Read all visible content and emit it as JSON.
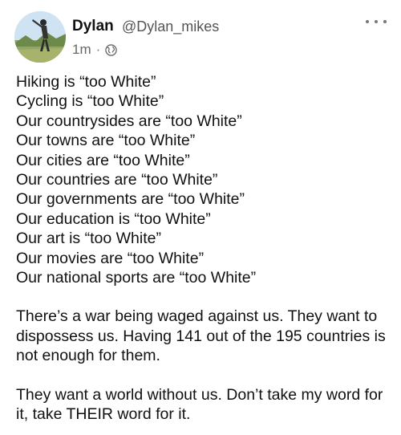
{
  "post": {
    "author_name": "Dylan",
    "author_handle": "@Dylan_mikes",
    "timestamp": "1m",
    "separator": "·",
    "visibility_icon": "globe-icon",
    "more_icon": "more-options-icon",
    "lines": [
      "Hiking is “too White”",
      "Cycling is “too White”",
      "Our countrysides are “too White”",
      "Our towns are “too White”",
      "Our cities are “too White”",
      "Our countries are “too White”",
      "Our governments are “too White”",
      "Our education is “too White”",
      "Our art is “too White”",
      "Our movies are “too White”",
      "Our national sports are “too White”"
    ],
    "paragraph_1": "There’s a war being waged against us. They want to dispossess us. Having 141 out of the 195 countries is not enough for them.",
    "paragraph_2": "They want a world without us. Don’t take my word for it, take THEIR word for it."
  },
  "colors": {
    "text": "#111111",
    "muted": "#666666"
  }
}
